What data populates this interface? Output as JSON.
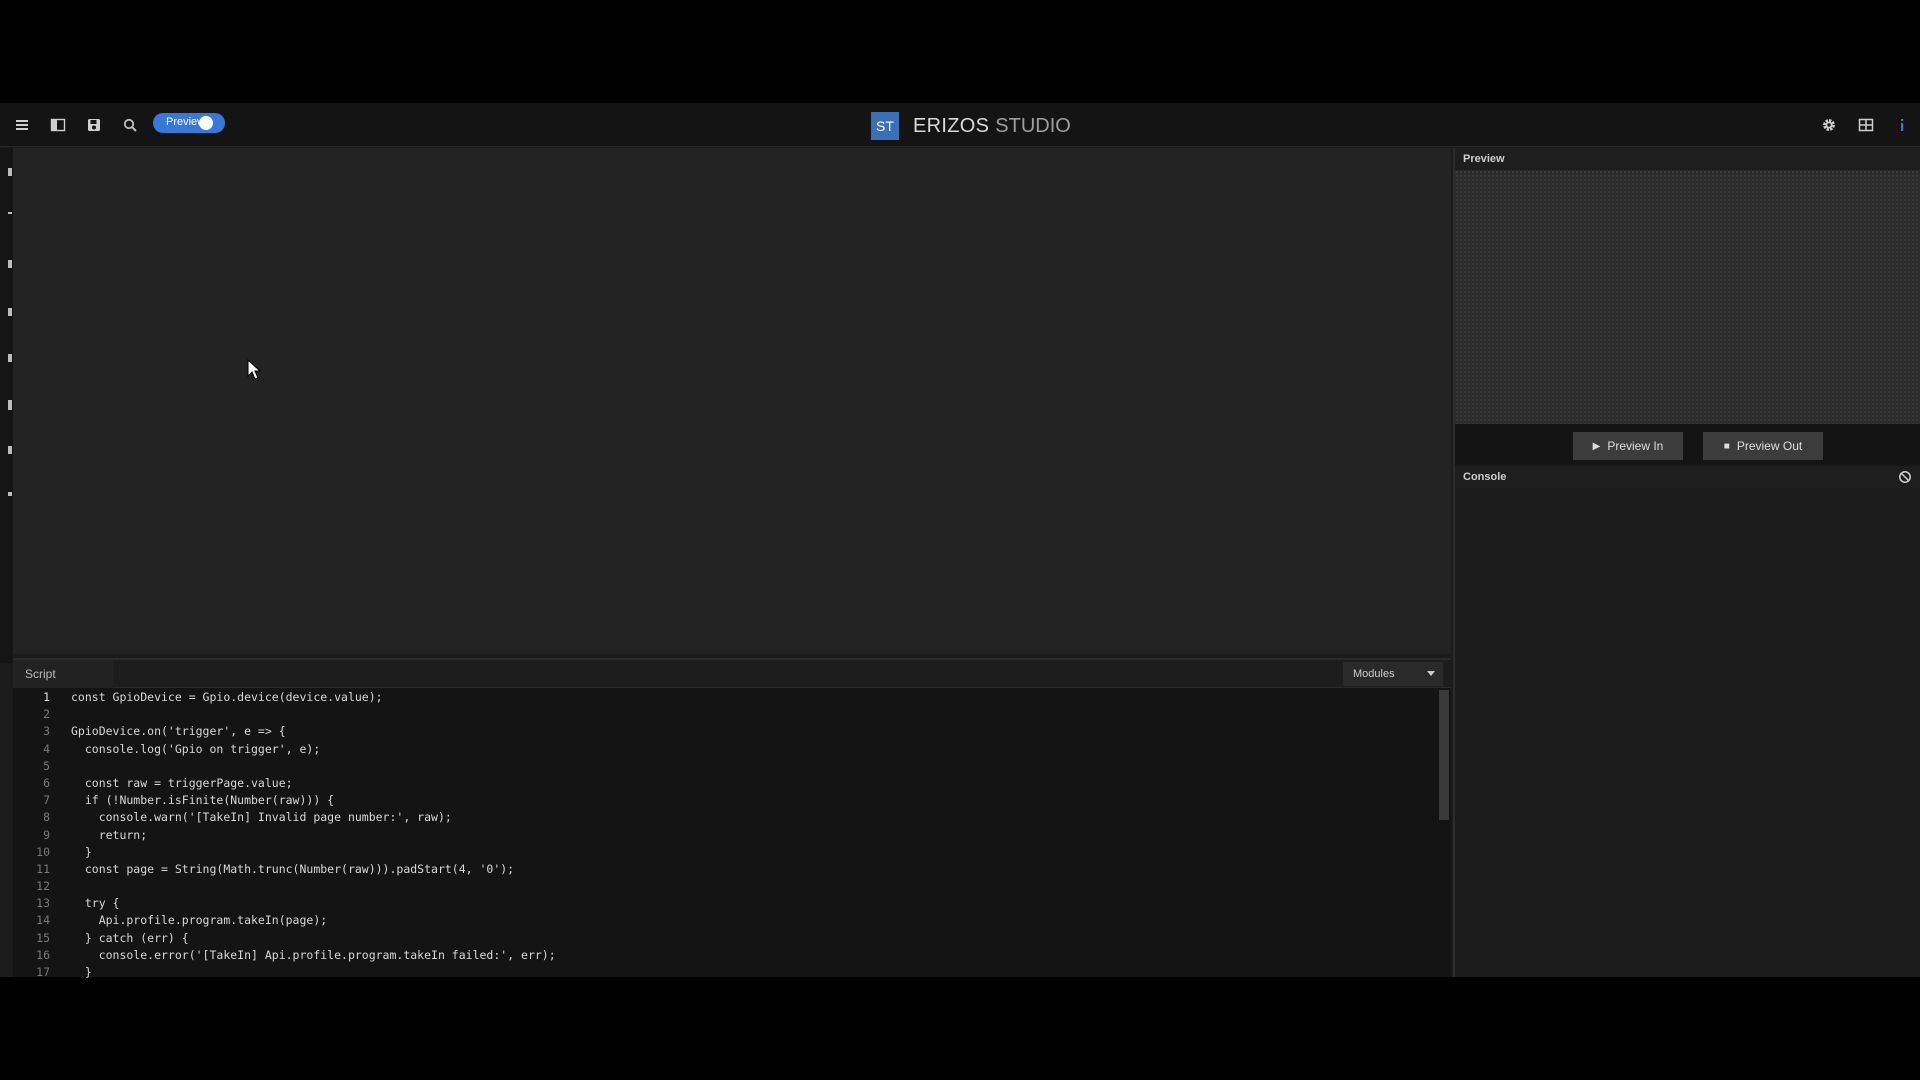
{
  "toolbar": {
    "preview_toggle_label": "Preview",
    "preview_toggle_on": true
  },
  "brand": {
    "logo_text": "ST",
    "name": "ERIZOS",
    "suffix": "STUDIO"
  },
  "script_panel": {
    "tab_label": "Script",
    "modules_label": "Modules",
    "lines": [
      {
        "n": "1",
        "text": "const GpioDevice = Gpio.device(device.value);"
      },
      {
        "n": "2",
        "text": ""
      },
      {
        "n": "3",
        "text": "GpioDevice.on('trigger', e => {"
      },
      {
        "n": "4",
        "text": "  console.log('Gpio on trigger', e);"
      },
      {
        "n": "5",
        "text": ""
      },
      {
        "n": "6",
        "text": "  const raw = triggerPage.value;"
      },
      {
        "n": "7",
        "text": "  if (!Number.isFinite(Number(raw))) {"
      },
      {
        "n": "8",
        "text": "    console.warn('[TakeIn] Invalid page number:', raw);"
      },
      {
        "n": "9",
        "text": "    return;"
      },
      {
        "n": "10",
        "text": "  }"
      },
      {
        "n": "11",
        "text": "  const page = String(Math.trunc(Number(raw))).padStart(4, '0');"
      },
      {
        "n": "12",
        "text": ""
      },
      {
        "n": "13",
        "text": "  try {"
      },
      {
        "n": "14",
        "text": "    Api.profile.program.takeIn(page);"
      },
      {
        "n": "15",
        "text": "  } catch (err) {"
      },
      {
        "n": "16",
        "text": "    console.error('[TakeIn] Api.profile.program.takeIn failed:', err);"
      },
      {
        "n": "17",
        "text": "  }"
      }
    ]
  },
  "preview_panel": {
    "title": "Preview",
    "preview_in_label": "Preview In",
    "preview_out_label": "Preview Out"
  },
  "console_panel": {
    "title": "Console"
  },
  "colors": {
    "accent": "#3a78d6",
    "logo": "#3b6fb8"
  }
}
